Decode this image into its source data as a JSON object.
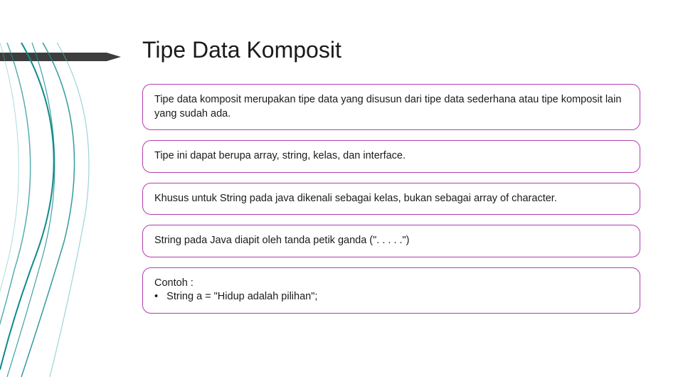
{
  "slide": {
    "title": "Tipe Data Komposit",
    "boxes": [
      {
        "text": "Tipe data komposit merupakan tipe data yang disusun dari tipe data sederhana atau tipe komposit lain yang sudah ada."
      },
      {
        "text": "Tipe ini dapat berupa array, string, kelas, dan interface."
      },
      {
        "text": "Khusus untuk String pada java dikenali sebagai kelas, bukan sebagai array of character."
      },
      {
        "text": "String pada Java diapit oleh tanda petik ganda (\". . . . .\")"
      },
      {
        "text": "Contoh :\n•   String a = \"Hidup adalah pilihan\";"
      }
    ],
    "colors": {
      "box_border": "#b23db2",
      "accent_dark": "#3d3d3d",
      "leaf_teal": "#0f8a8c"
    }
  }
}
